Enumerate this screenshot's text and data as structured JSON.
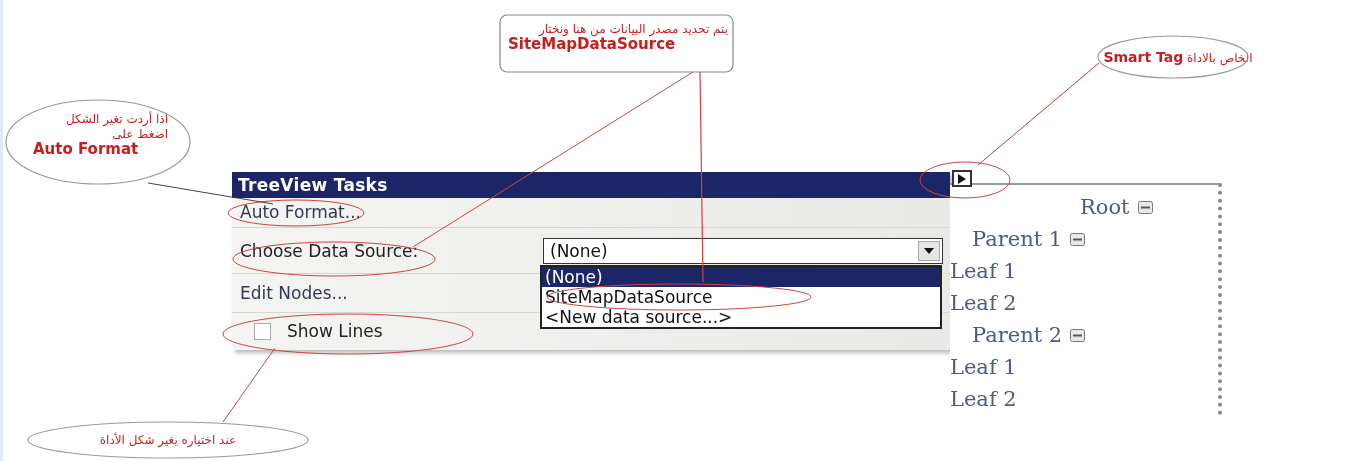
{
  "tasks_panel": {
    "title": "TreeView Tasks",
    "items": [
      {
        "kind": "link",
        "label": "Auto Format..."
      },
      {
        "kind": "dropdown",
        "label": "Choose Data Source:",
        "value": "(None)",
        "expanded": true,
        "options": [
          {
            "label": "(None)",
            "selected": true
          },
          {
            "label": "SiteMapDataSource",
            "selected": false
          },
          {
            "label": "<New data source...>",
            "selected": false
          }
        ]
      },
      {
        "kind": "link",
        "label": "Edit Nodes..."
      },
      {
        "kind": "checkbox",
        "label": "Show Lines",
        "checked": false
      }
    ]
  },
  "tree": {
    "nodes": [
      {
        "label": "Root",
        "expanded": true,
        "children": [
          {
            "label": "Parent 1",
            "expanded": true,
            "children": [
              {
                "label": "Leaf 1"
              },
              {
                "label": "Leaf 2"
              }
            ]
          },
          {
            "label": "Parent 2",
            "expanded": true,
            "children": [
              {
                "label": "Leaf 1"
              },
              {
                "label": "Leaf 2"
              }
            ]
          }
        ]
      }
    ]
  },
  "annotations": [
    {
      "kind": "ellipse",
      "text": "اذا أردت تغير الشكل اضغط على",
      "highlight": "Auto Format"
    },
    {
      "kind": "box",
      "text": "يتم تحديد مصدر البيانات من هنا ونختار",
      "highlight": "SiteMapDataSource"
    },
    {
      "kind": "ellipse",
      "text": "الخاص بالاداة",
      "highlight": "Smart Tag"
    },
    {
      "kind": "ellipse",
      "text": "عند اختياره يغير شكل الأداة"
    }
  ]
}
